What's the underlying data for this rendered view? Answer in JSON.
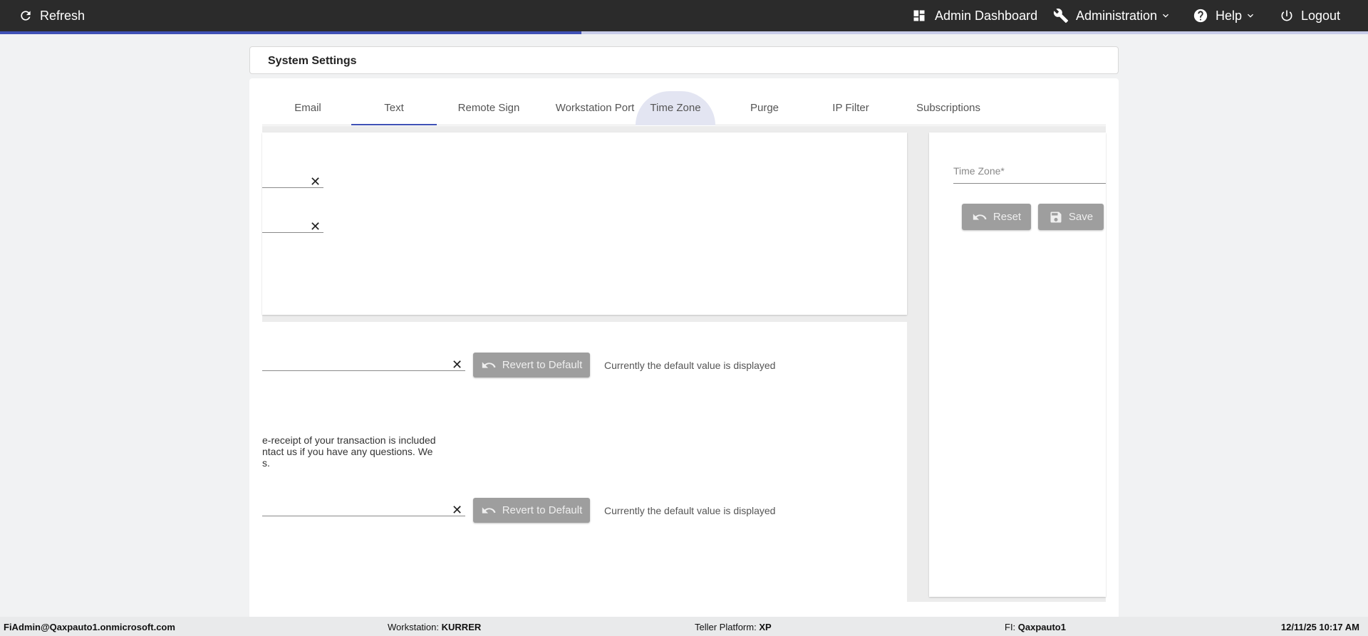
{
  "topbar": {
    "refresh_label": "Refresh",
    "admin_dashboard_label": "Admin Dashboard",
    "administration_label": "Administration",
    "help_label": "Help",
    "logout_label": "Logout",
    "progress_fraction": 0.425,
    "icons": {
      "refresh": "refresh-icon",
      "dashboard": "dashboard-icon",
      "administration": "wrench-icon",
      "help": "help-icon",
      "logout": "power-icon",
      "dropdown": "chevron-down-icon"
    }
  },
  "page": {
    "title": "System Settings"
  },
  "tabs": [
    {
      "label": "Email"
    },
    {
      "label": "Text"
    },
    {
      "label": "Remote Sign"
    },
    {
      "label": "Workstation Port"
    },
    {
      "label": "Time Zone"
    },
    {
      "label": "Purge"
    },
    {
      "label": "IP Filter"
    },
    {
      "label": "Subscriptions"
    }
  ],
  "active_tab": "Text",
  "text_settings": {
    "revert_button_label": "Revert to Default",
    "default_note": "Currently the default value is displayed",
    "message_line1": "e-receipt of your transaction is included",
    "message_line2": "ntact us if you have any questions. We",
    "message_line3": "s."
  },
  "time_zone": {
    "label": "Time Zone*",
    "reset_label": "Reset",
    "save_label": "Save"
  },
  "footer": {
    "user": "FiAdmin@Qaxpauto1.onmicrosoft.com",
    "workstation_label": "Workstation:",
    "workstation_value": "KURRER",
    "teller_label": "Teller Platform:",
    "teller_value": "XP",
    "fi_label": "FI:",
    "fi_value": "Qaxpauto1",
    "datetime": "12/11/25 10:17 AM"
  },
  "colors": {
    "topbar": "#2b2b2b",
    "accent": "#3f51b5",
    "disabled_button": "#9e9e9e"
  }
}
